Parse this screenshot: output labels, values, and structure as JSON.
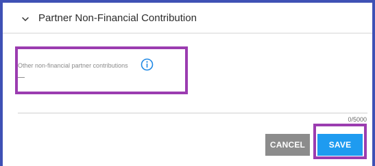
{
  "section": {
    "title": "Partner Non-Financial Contribution",
    "chevron_icon": "chevron-down-icon"
  },
  "field": {
    "label": "Other non-financial partner contributions",
    "value": "—",
    "info_icon": "info-icon"
  },
  "textarea": {
    "counter": "0/5000"
  },
  "actions": {
    "cancel_label": "CANCEL",
    "save_label": "SAVE"
  },
  "colors": {
    "frame_border": "#3f51b5",
    "highlight": "#9b3cb0",
    "info_icon": "#1e88e5",
    "save_button": "#1e9bf0",
    "cancel_button": "#8c8c8c"
  }
}
